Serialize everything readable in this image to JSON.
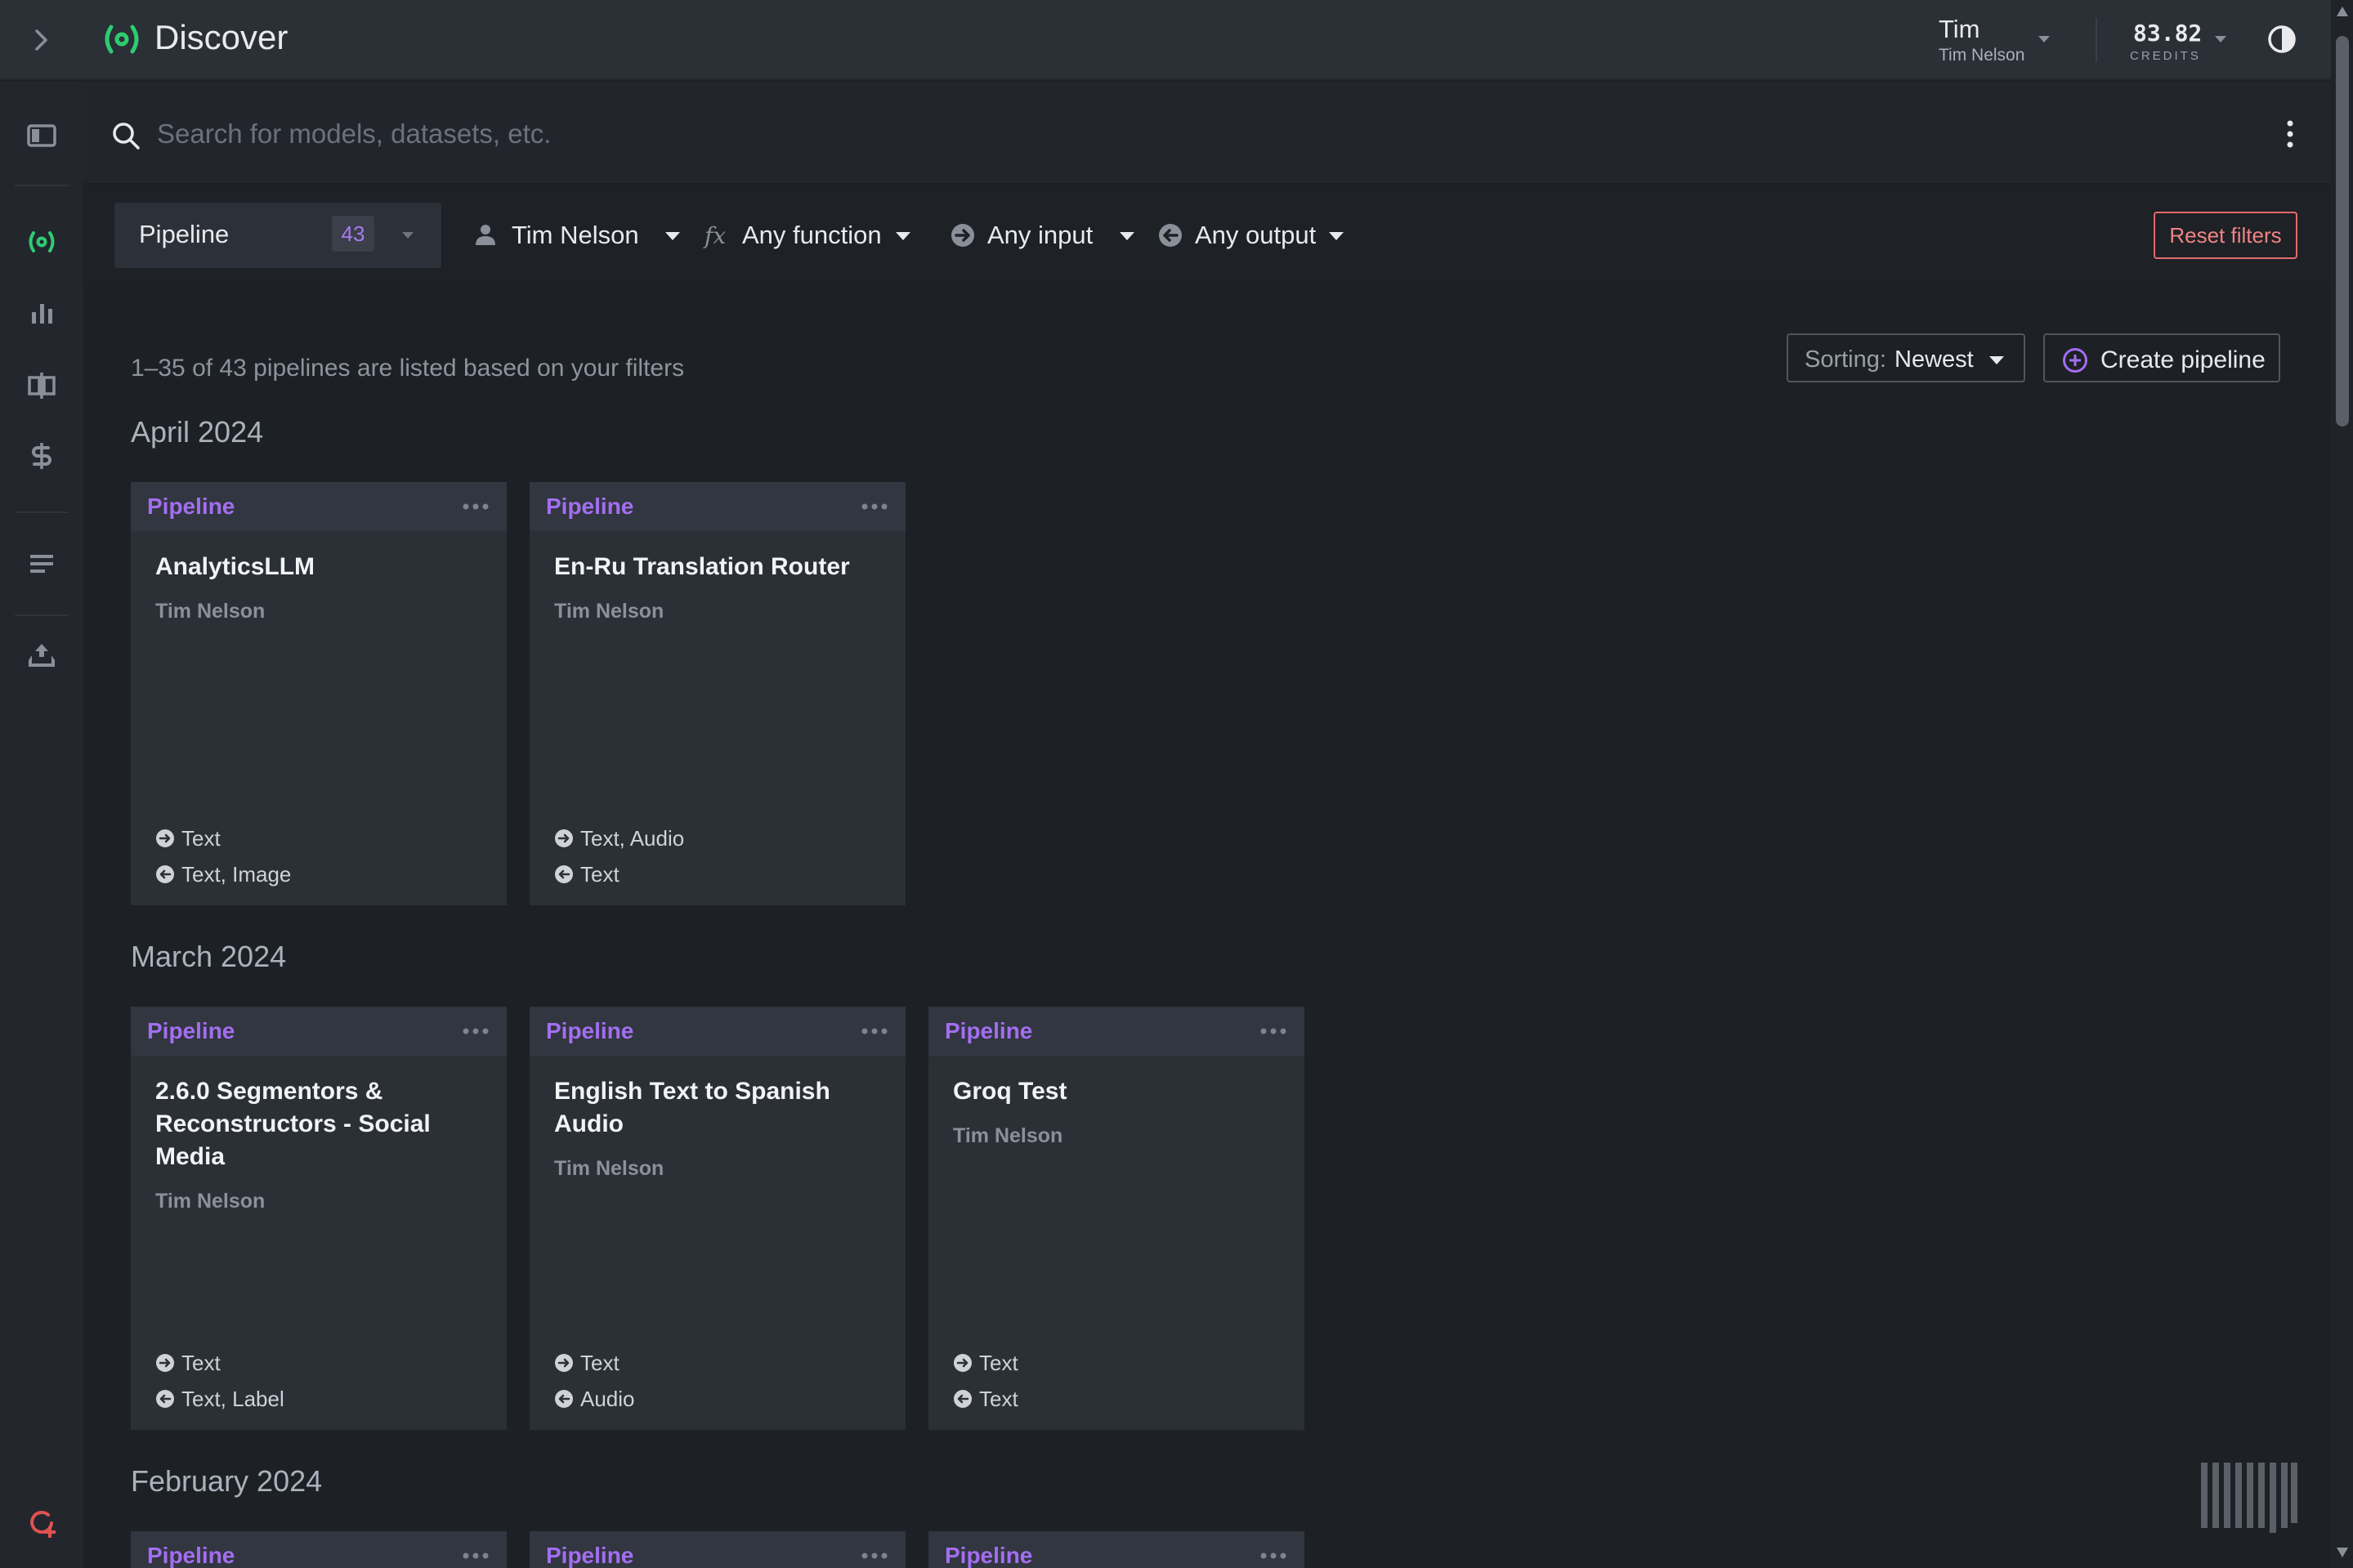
{
  "header": {
    "title": "Discover",
    "user_first_name": "Tim",
    "user_full_name": "Tim Nelson",
    "credits_value": "83.82",
    "credits_label": "CREDITS"
  },
  "search": {
    "placeholder": "Search for models, datasets, etc."
  },
  "filters": {
    "type_label": "Pipeline",
    "type_count": "43",
    "owner_label": "Tim Nelson",
    "function_label": "Any function",
    "input_label": "Any input",
    "output_label": "Any output",
    "reset_label": "Reset filters"
  },
  "list": {
    "summary": "1–35 of 43 pipelines are listed based on your filters",
    "sort_prefix": "Sorting:",
    "sort_value": "Newest",
    "create_label": "Create pipeline"
  },
  "groups": [
    {
      "month": "April 2024",
      "cards": [
        {
          "type": "Pipeline",
          "title": "AnalyticsLLM",
          "author": "Tim Nelson",
          "input": "Text",
          "output": "Text, Image"
        },
        {
          "type": "Pipeline",
          "title": "En-Ru Translation Router",
          "author": "Tim Nelson",
          "input": "Text, Audio",
          "output": "Text"
        }
      ]
    },
    {
      "month": "March 2024",
      "cards": [
        {
          "type": "Pipeline",
          "title": "2.6.0 Segmentors & Reconstructors - Social Media",
          "author": "Tim Nelson",
          "input": "Text",
          "output": "Text, Label"
        },
        {
          "type": "Pipeline",
          "title": "English Text to Spanish Audio",
          "author": "Tim Nelson",
          "input": "Text",
          "output": "Audio"
        },
        {
          "type": "Pipeline",
          "title": "Groq Test",
          "author": "Tim Nelson",
          "input": "Text",
          "output": "Text"
        }
      ]
    },
    {
      "month": "February 2024",
      "cards": [
        {
          "type": "Pipeline"
        },
        {
          "type": "Pipeline"
        },
        {
          "type": "Pipeline"
        }
      ]
    }
  ],
  "colors": {
    "accent_green": "#2ecc71",
    "accent_purple": "#a36ef0",
    "danger": "#e26b6b"
  },
  "icons": {
    "rail": [
      "panel-icon",
      "discover-icon",
      "analytics-icon",
      "compare-icon",
      "billing-icon",
      "list-icon",
      "upload-icon",
      "support-icon"
    ]
  }
}
